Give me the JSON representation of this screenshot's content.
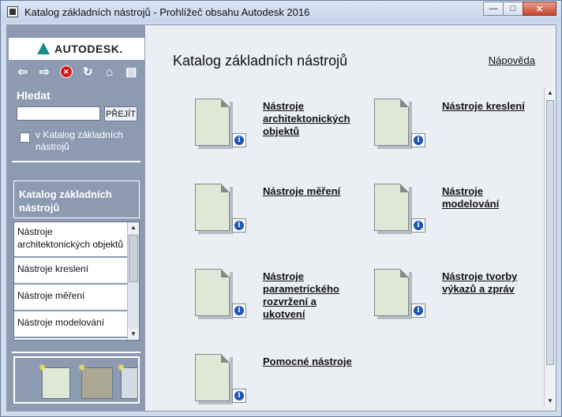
{
  "window": {
    "title": "Katalog základních nástrojů - Prohlížeč obsahu Autodesk 2016",
    "minimize": "—",
    "maximize": "□",
    "close": "✕"
  },
  "sidebar": {
    "logo_text": "AUTODESK.",
    "nav_icons": [
      "back-icon",
      "forward-icon",
      "stop-icon",
      "refresh-icon",
      "home-icon",
      "print-icon"
    ],
    "nav": {
      "back": "⇦",
      "forward": "⇨",
      "stop": "✕",
      "refresh": "↻",
      "home": "⌂",
      "print": "▤"
    },
    "search_label": "Hledat",
    "search_value": "",
    "go_label": "PŘEJÍT",
    "scope_label": "v Katalog základních nástrojů",
    "catalog_label": "Katalog základních nástrojů",
    "list": [
      "Nástroje architektonických objektů",
      "Nástroje kreslení",
      "Nástroje měření",
      "Nástroje modelování"
    ]
  },
  "main": {
    "title": "Katalog základních nástrojů",
    "help": "Nápověda",
    "tiles": [
      "Nástroje architektonických objektů",
      "Nástroje kreslení",
      "Nástroje měření",
      "Nástroje modelování",
      "Nástroje parametrického rozvržení a ukotvení",
      "Nástroje tvorby výkazů a zpráv",
      "Pomocné nástroje"
    ]
  },
  "colors": {
    "sidebar": "#8d9bb2",
    "main_bg": "#ebeef2",
    "doc": "#dfe7d6",
    "info": "#1a55b6"
  }
}
